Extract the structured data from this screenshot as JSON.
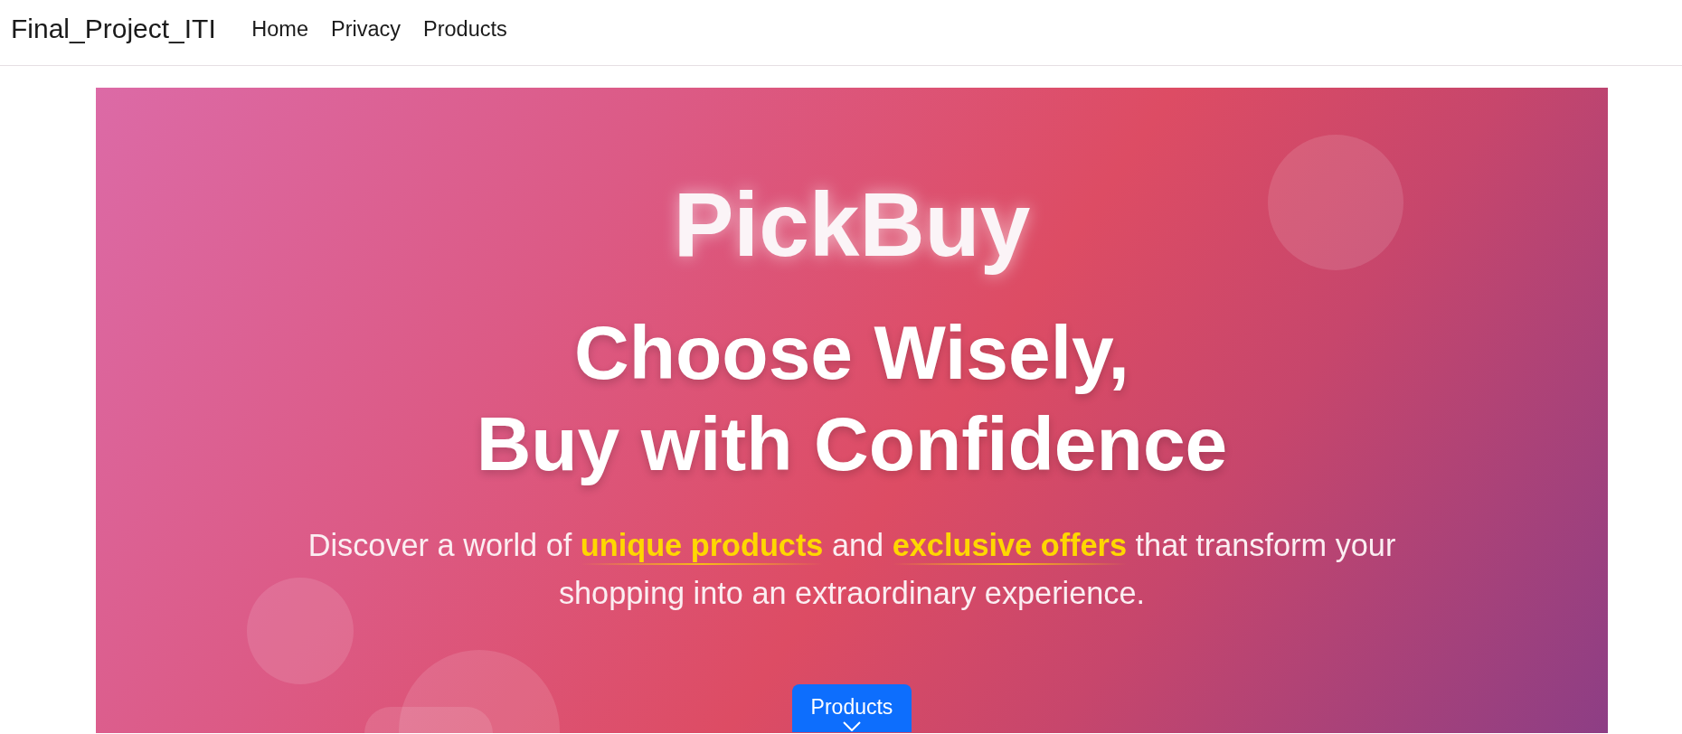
{
  "navbar": {
    "brand": "Final_Project_ITI",
    "links": [
      {
        "label": "Home"
      },
      {
        "label": "Privacy"
      },
      {
        "label": "Products"
      }
    ]
  },
  "hero": {
    "brand": "PickBuy",
    "headline": [
      "Choose Wisely,",
      "Buy with Confidence"
    ],
    "tagline": "Discover a world of **unique products** and **exclusive offers** that transform your shopping into an extraordinary experience.",
    "button": {
      "label": "Products"
    }
  }
}
